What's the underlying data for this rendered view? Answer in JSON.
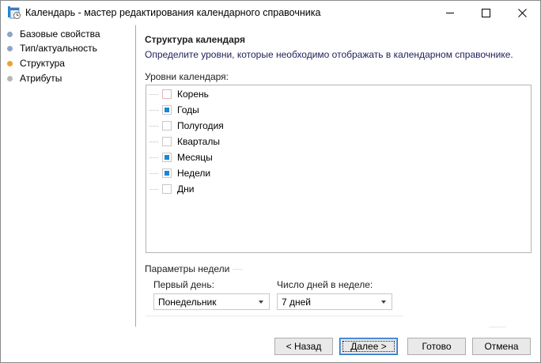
{
  "window": {
    "title": "Календарь - мастер редактирования календарного справочника"
  },
  "nav": {
    "items": [
      {
        "label": "Базовые свойства",
        "dot_color": "#8fa3c6"
      },
      {
        "label": "Тип/актуальность",
        "dot_color": "#8fa3c6"
      },
      {
        "label": "Структура",
        "dot_color": "#f0a030"
      },
      {
        "label": "Атрибуты",
        "dot_color": "#b7b7b7"
      }
    ]
  },
  "content": {
    "title": "Структура календаря",
    "description": "Определите уровни, которые необходимо отображать в календарном справочнике.",
    "levels_label": "Уровни календаря:",
    "levels": [
      {
        "label": "Корень",
        "checked": false
      },
      {
        "label": "Годы",
        "checked": true
      },
      {
        "label": "Полугодия",
        "checked": false
      },
      {
        "label": "Кварталы",
        "checked": false
      },
      {
        "label": "Месяцы",
        "checked": true
      },
      {
        "label": "Недели",
        "checked": true
      },
      {
        "label": "Дни",
        "checked": false
      }
    ],
    "week_params": {
      "legend": "Параметры недели",
      "first_day_label": "Первый день:",
      "first_day_value": "Понедельник",
      "days_count_label": "Число дней в неделе:",
      "days_count_value": "7 дней"
    }
  },
  "buttons": {
    "back": "< Назад",
    "next": "Далее >",
    "finish": "Готово",
    "cancel": "Отмена"
  },
  "colors": {
    "accent": "#1b86d1",
    "active_step": "#f0a030"
  },
  "icons": {
    "app": "calendar-wizard-icon",
    "minimize": "minimize-icon",
    "maximize": "maximize-icon",
    "close": "close-icon",
    "dropdown": "chevron-down-icon"
  }
}
